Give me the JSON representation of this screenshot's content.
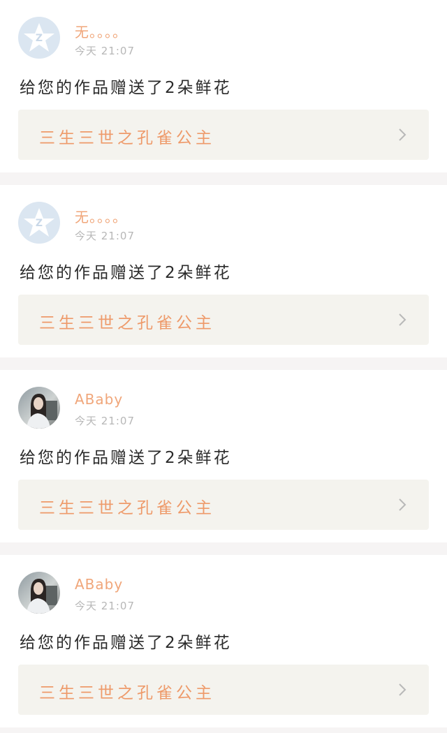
{
  "notifications": [
    {
      "avatar": "default-avatar-icon",
      "username": "无。。。。",
      "time": "今天 21:07",
      "message": "给您的作品赠送了2朵鲜花",
      "work_title": "三生三世之孔雀公主"
    },
    {
      "avatar": "default-avatar-icon",
      "username": "无。。。。",
      "time": "今天 21:07",
      "message": "给您的作品赠送了2朵鲜花",
      "work_title": "三生三世之孔雀公主"
    },
    {
      "avatar": "user-photo",
      "username": "ABaby",
      "time": "今天 21:07",
      "message": "给您的作品赠送了2朵鲜花",
      "work_title": "三生三世之孔雀公主"
    },
    {
      "avatar": "user-photo",
      "username": "ABaby",
      "time": "今天 21:07",
      "message": "给您的作品赠送了2朵鲜花",
      "work_title": "三生三世之孔雀公主"
    }
  ],
  "colors": {
    "username": "#f0a67a",
    "work_title": "#ee9a6a",
    "link_background": "#f4f3ee",
    "page_background": "#f6f4f4"
  }
}
